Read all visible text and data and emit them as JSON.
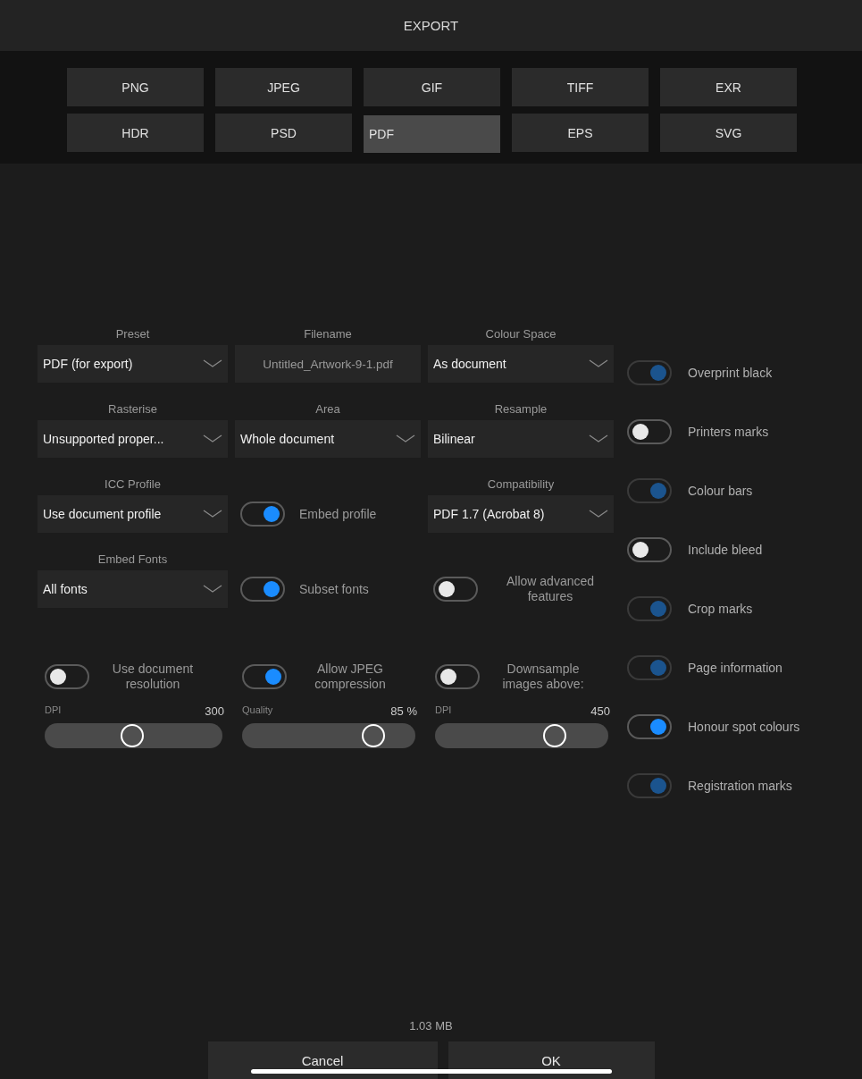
{
  "title": "EXPORT",
  "formats": [
    {
      "label": "PNG",
      "selected": false
    },
    {
      "label": "JPEG",
      "selected": false
    },
    {
      "label": "GIF",
      "selected": false
    },
    {
      "label": "TIFF",
      "selected": false
    },
    {
      "label": "EXR",
      "selected": false
    },
    {
      "label": "HDR",
      "selected": false
    },
    {
      "label": "PSD",
      "selected": false
    },
    {
      "label": "PDF",
      "selected": true
    },
    {
      "label": "EPS",
      "selected": false
    },
    {
      "label": "SVG",
      "selected": false
    }
  ],
  "settings": [
    {
      "kind": "select",
      "label": "Preset",
      "value": "PDF (for export)"
    },
    {
      "kind": "field",
      "label": "Filename",
      "value": "Untitled_Artwork-9-1.pdf"
    },
    {
      "kind": "select",
      "label": "Colour Space",
      "value": "As document"
    },
    {
      "kind": "select",
      "label": "Rasterise",
      "value": "Unsupported proper..."
    },
    {
      "kind": "select",
      "label": "Area",
      "value": "Whole document"
    },
    {
      "kind": "select",
      "label": "Resample",
      "value": "Bilinear"
    },
    {
      "kind": "select",
      "label": "ICC Profile",
      "value": "Use document profile"
    },
    {
      "kind": "toggle",
      "text": "Embed profile",
      "on": true
    },
    {
      "kind": "select",
      "label": "Compatibility",
      "value": "PDF 1.7 (Acrobat 8)"
    },
    {
      "kind": "select",
      "label": "Embed Fonts",
      "value": "All fonts"
    },
    {
      "kind": "toggle",
      "text": "Subset fonts",
      "on": true
    },
    {
      "kind": "toggle",
      "text": "Allow advanced features",
      "on": false
    }
  ],
  "sliders": [
    {
      "toggle": {
        "text": "Use document resolution",
        "on": false
      },
      "label": "DPI",
      "reading": "300",
      "level": 0.49
    },
    {
      "toggle": {
        "text": "Allow JPEG compression",
        "on": true
      },
      "label": "Quality",
      "reading": "85 %",
      "level": 0.8
    },
    {
      "toggle": {
        "text": "Downsample images above:",
        "on": false
      },
      "label": "DPI",
      "reading": "450",
      "level": 0.72
    }
  ],
  "options": [
    {
      "text": "Overprint black",
      "on": true,
      "disabled": true
    },
    {
      "text": "Printers marks",
      "on": false,
      "disabled": false
    },
    {
      "text": "Colour bars",
      "on": true,
      "disabled": true
    },
    {
      "text": "Include bleed",
      "on": false,
      "disabled": false
    },
    {
      "text": "Crop marks",
      "on": true,
      "disabled": true
    },
    {
      "text": "Page information",
      "on": true,
      "disabled": true
    },
    {
      "text": "Honour spot colours",
      "on": true,
      "disabled": false
    },
    {
      "text": "Registration marks",
      "on": true,
      "disabled": true
    }
  ],
  "file_size": "1.03 MB",
  "buttons": [
    "Cancel",
    "OK"
  ]
}
